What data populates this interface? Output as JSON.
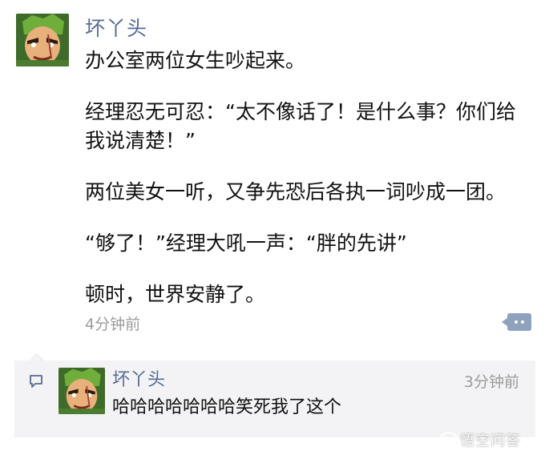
{
  "post": {
    "author": "坏丫头",
    "avatar_icon": "avatar-icon",
    "paragraphs": [
      "办公室两位女生吵起来。",
      "经理忍无可忍：“太不像话了！是什么事？你们给我说清楚！”",
      "两位美女一听，又争先恐后各执一词吵成一团。",
      "“够了！”经理大吼一声：“胖的先讲”",
      "顿时，世界安静了。"
    ],
    "time": "4分钟前",
    "comment_button_icon": "comment-more-icon"
  },
  "comment": {
    "icon": "comment-bubble-icon",
    "author": "坏丫头",
    "text": "哈哈哈哈哈哈哈笑死我了这个",
    "time": "3分钟前"
  },
  "watermark": {
    "text": "悟空问答"
  },
  "colors": {
    "author_link": "#576b95",
    "time_gray": "#9b9b9b",
    "comment_bg": "#f3f3f5",
    "comment_button": "#8fa2bd"
  }
}
